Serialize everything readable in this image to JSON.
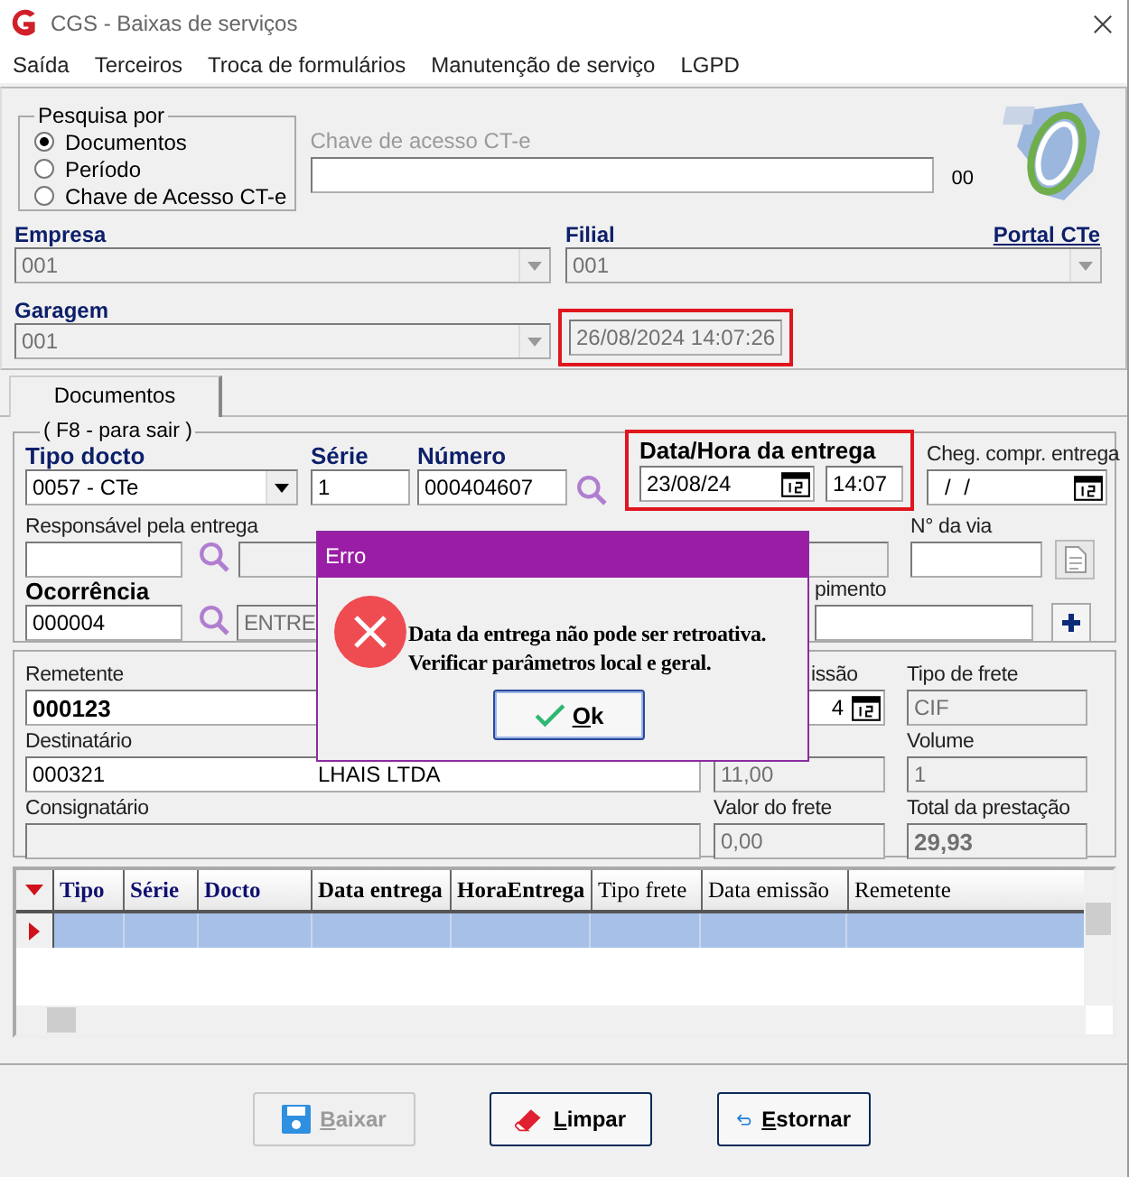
{
  "window": {
    "title": "CGS - Baixas de serviços"
  },
  "menu": [
    "Saída",
    "Terceiros",
    "Troca de formulários",
    "Manutenção de serviço",
    "LGPD"
  ],
  "search": {
    "legend": "Pesquisa por",
    "options": [
      {
        "label": "Documentos",
        "selected": true
      },
      {
        "label": "Período",
        "selected": false
      },
      {
        "label": "Chave de Acesso CT-e",
        "selected": false
      }
    ],
    "key_label": "Chave de acesso CT-e",
    "key_suffix": "00",
    "portal_link": "Portal CTe"
  },
  "empresa": {
    "label": "Empresa",
    "value": "001"
  },
  "filial": {
    "label": "Filial",
    "value": "001"
  },
  "garagem": {
    "label": "Garagem",
    "value": "001"
  },
  "timestamp": {
    "value": "26/08/2024 14:07:26",
    "highlighted": true
  },
  "tabs": [
    {
      "label": "Documentos",
      "selected": true
    }
  ],
  "entry": {
    "legend": "( F8 - para sair )",
    "tipo_docto": {
      "label": "Tipo docto",
      "value": "0057 - CTe"
    },
    "serie": {
      "label": "Série",
      "value": "1"
    },
    "numero": {
      "label": "Número",
      "value": "000404607"
    },
    "delivery": {
      "label": "Data/Hora da entrega",
      "date": "23/08/24",
      "time": "14:07",
      "highlighted": true
    },
    "cheg": {
      "label": "Cheg. compr. entrega",
      "value": "/ /"
    },
    "responsavel": {
      "label": "Responsável pela entrega"
    },
    "via": {
      "label": "N° da via"
    },
    "ocorrencia": {
      "label": "Ocorrência",
      "code": "000004",
      "description": "ENTRE"
    },
    "extra_label": "pimento"
  },
  "details": {
    "remetente": {
      "label": "Remetente",
      "value": "000123"
    },
    "emissao": {
      "label": "issão",
      "value": "4"
    },
    "tipo_frete": {
      "label": "Tipo de frete",
      "value": "CIF"
    },
    "destinatario": {
      "label": "Destinatário",
      "code": "000321",
      "name": "LHAIS LTDA"
    },
    "peso": {
      "value": "11,00"
    },
    "volume": {
      "label": "Volume",
      "value": "1"
    },
    "consignatario": {
      "label": "Consignatário"
    },
    "valor_frete": {
      "label": "Valor do frete",
      "value": "0,00"
    },
    "total": {
      "label": "Total da prestação",
      "value": "29,93"
    }
  },
  "grid": {
    "columns": [
      {
        "label": "Tipo"
      },
      {
        "label": "Série"
      },
      {
        "label": "Docto"
      },
      {
        "label": "Data entrega"
      },
      {
        "label": "HoraEntrega"
      },
      {
        "label": "Tipo frete"
      },
      {
        "label": "Data emissão"
      },
      {
        "label": "Remetente"
      }
    ],
    "rows": [
      {
        "selected": true
      }
    ]
  },
  "buttons": [
    {
      "label": "Baixar",
      "kind": "save",
      "disabled": true
    },
    {
      "label": "Limpar",
      "kind": "erase",
      "disabled": false
    },
    {
      "label": "Estornar",
      "kind": "undo",
      "disabled": false
    }
  ],
  "dialog": {
    "title": "Erro",
    "lines": [
      "Data da entrega não pode ser retroativa.",
      "Verificar parâmetros local e geral."
    ],
    "button": "Ok"
  }
}
